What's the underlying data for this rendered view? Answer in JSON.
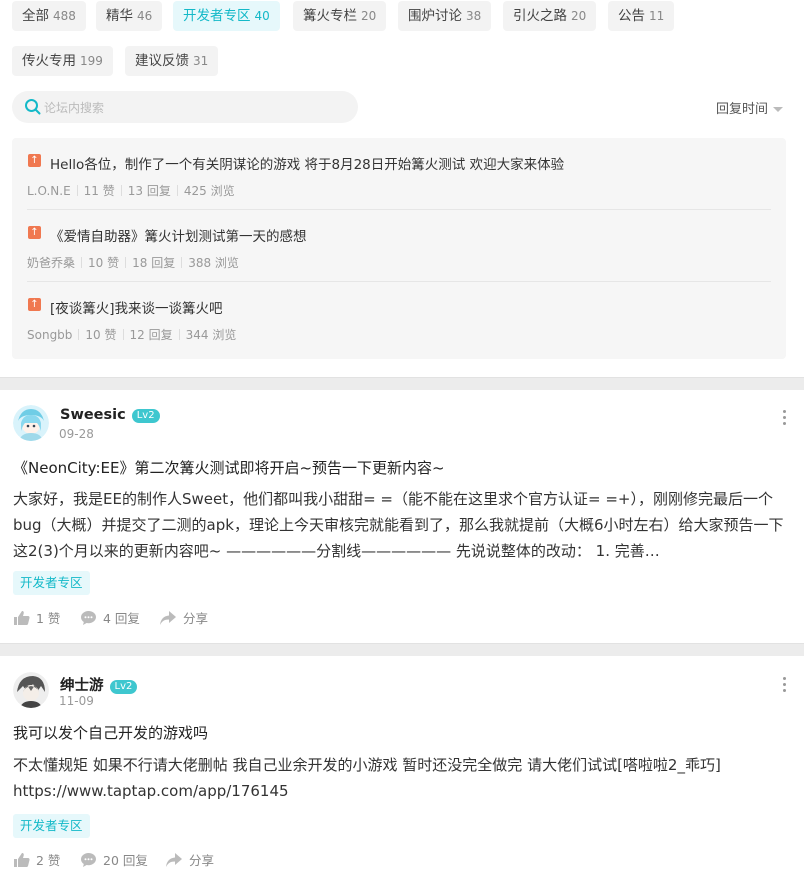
{
  "tabs": [
    {
      "label": "全部",
      "count": "488"
    },
    {
      "label": "精华",
      "count": "46"
    },
    {
      "label": "开发者专区",
      "count": "40"
    },
    {
      "label": "篝火专栏",
      "count": "20"
    },
    {
      "label": "围炉讨论",
      "count": "38"
    },
    {
      "label": "引火之路",
      "count": "20"
    },
    {
      "label": "公告",
      "count": "11"
    },
    {
      "label": "传火专用",
      "count": "199"
    },
    {
      "label": "建议反馈",
      "count": "31"
    }
  ],
  "search": {
    "placeholder": "论坛内搜索",
    "value": ""
  },
  "sort": {
    "label": "回复时间"
  },
  "pinned": [
    {
      "icon": "top-arrow-icon",
      "title": "Hello各位，制作了一个有关阴谋论的游戏 将于8月28日开始篝火测试 欢迎大家来体验",
      "author": "L.O.N.E",
      "likes": "11 赞",
      "replies": "13 回复",
      "views": "425 浏览"
    },
    {
      "icon": "top-arrow-icon",
      "title": "《爱情自助器》篝火计划测试第一天的感想",
      "author": "奶爸乔桑",
      "likes": "10 赞",
      "replies": "18 回复",
      "views": "388 浏览"
    },
    {
      "icon": "top-arrow-icon",
      "title": "[夜谈篝火]我来谈一谈篝火吧",
      "author": "Songbb",
      "likes": "10 赞",
      "replies": "12 回复",
      "views": "344 浏览"
    }
  ],
  "posts": [
    {
      "author": "Sweesic",
      "level": "Lv2",
      "date": "09-28",
      "title": "《NeonCity:EE》第二次篝火测试即将开启~预告一下更新内容~",
      "body": "大家好，我是EE的制作人Sweet，他们都叫我小甜甜= =（能不能在这里求个官方认证= =+），刚刚修完最后一个bug（大概）并提交了二测的apk，理论上今天审核完就能看到了，那么我就提前（大概6小时左右）给大家预告一下这2(3)个月以来的更新内容吧~ ——————分割线—————— 先说说整体的改动： 1. 完善…",
      "tag": "开发者专区",
      "likes": "1 赞",
      "replies": "4 回复",
      "share": "分享"
    },
    {
      "author": "绅士游",
      "level": "Lv2",
      "date": "11-09",
      "title": "我可以发个自己开发的游戏吗",
      "body": "不太懂规矩 如果不行请大佬删帖 我自己业余开发的小游戏 暂时还没完全做完 请大佬们试试[嗒啦啦2_乖巧] https://www.taptap.com/app/176145",
      "tag": "开发者专区",
      "likes": "2 赞",
      "replies": "20 回复",
      "share": "分享"
    }
  ],
  "colors": {
    "accent": "#14b9c8",
    "pin_icon": "#f07850",
    "level_badge": "#3ec7cf"
  }
}
